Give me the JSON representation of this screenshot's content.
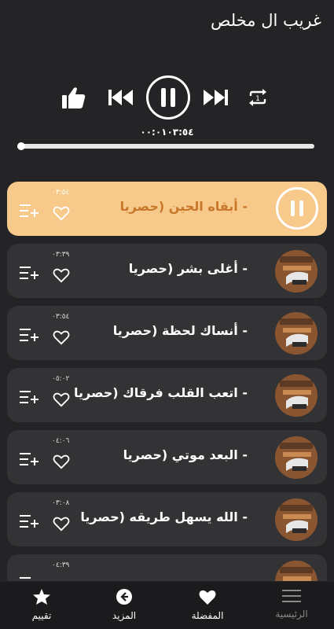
{
  "header": {
    "title": "غريب ال مخلص"
  },
  "player": {
    "time": "٠٠:٠١٠٣:٥٤",
    "progress": 0.0
  },
  "tracks": [
    {
      "title": "- أبقاه الحين (حصريا",
      "duration": "٠٣:٥٤",
      "active": true
    },
    {
      "title": "- أغلى بشر (حصريا",
      "duration": "٠٣:٣٩",
      "active": false
    },
    {
      "title": "- أنساك لحظة (حصريا",
      "duration": "٠٣:٥٤",
      "active": false
    },
    {
      "title": "- اتعب القلب فرقاك (حصريا",
      "duration": "٠٥:٠٢",
      "active": false
    },
    {
      "title": "- البعد موتي (حصريا",
      "duration": "٠٤:٠٦",
      "active": false
    },
    {
      "title": "- الله يسهل طريقه (حصريا",
      "duration": "٠٣:٠٨",
      "active": false
    },
    {
      "title": "",
      "duration": "٠٤:٣٩",
      "active": false
    }
  ],
  "nav": {
    "home": "الرئيسية",
    "favorites": "المفضلة",
    "more": "المزيد",
    "rate": "تقييم"
  },
  "colors": {
    "background": "#242426",
    "row": "#333335",
    "active_row": "#f7c98a",
    "active_text": "#c8762a"
  }
}
